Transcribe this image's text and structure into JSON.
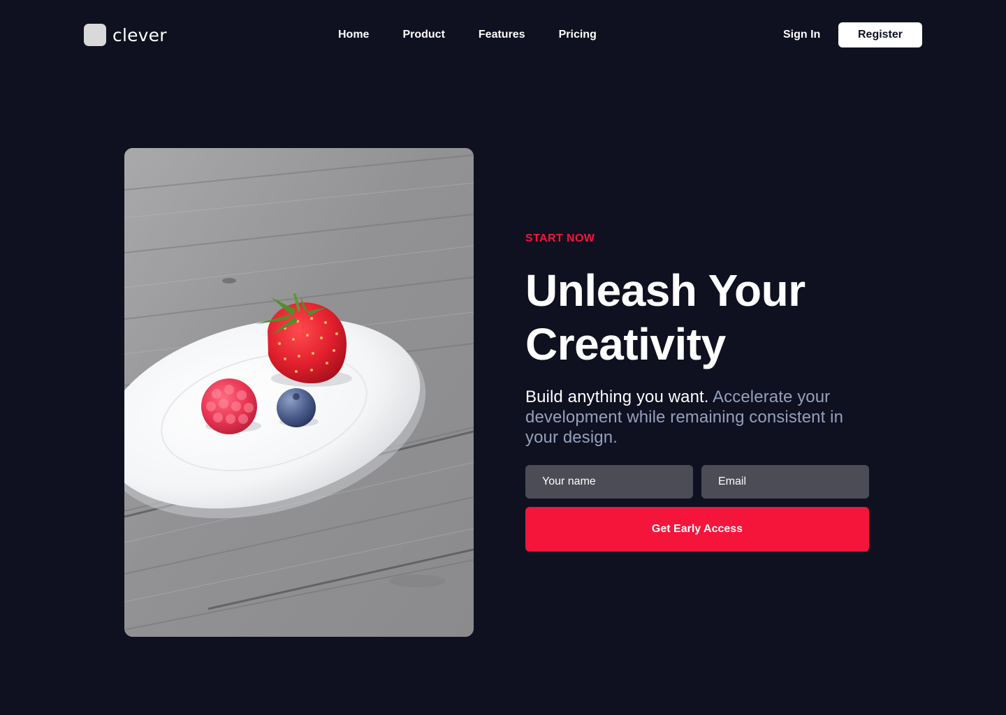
{
  "header": {
    "brand": "clever",
    "nav": [
      "Home",
      "Product",
      "Features",
      "Pricing"
    ],
    "sign_in": "Sign In",
    "register": "Register"
  },
  "hero": {
    "eyebrow": "START NOW",
    "headline_line1": "Unleash Your",
    "headline_line2": "Creativity",
    "subtext_lead": "Build anything you want.",
    "subtext_rest": "Accelerate your development while remaining consistent in your design.",
    "form": {
      "name_placeholder": "Your name",
      "email_placeholder": "Email",
      "cta": "Get Early Access"
    },
    "image_alt": "Strawberry, raspberry and blueberry on a white plate on a wooden table"
  },
  "colors": {
    "background": "#0f1020",
    "accent": "#f5153a",
    "muted_text": "#93a1bd",
    "input_bg": "#4c4c57"
  }
}
